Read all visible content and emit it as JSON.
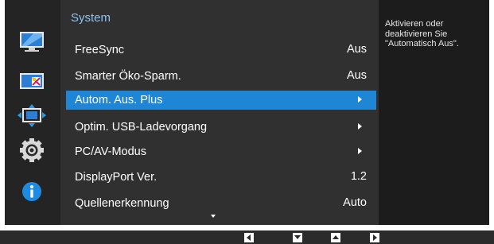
{
  "menu": {
    "title": "System",
    "items": [
      {
        "label": "FreeSync",
        "value": "Aus",
        "type": "value"
      },
      {
        "label": "Smarter Öko-Sparm.",
        "value": "Aus",
        "type": "value"
      },
      {
        "label": "Autom. Aus. Plus",
        "value": "",
        "type": "arrow",
        "selected": true
      },
      {
        "label": "Optim. USB-Ladevorgang",
        "value": "",
        "type": "arrow"
      },
      {
        "label": "PC/AV-Modus",
        "value": "",
        "type": "arrow"
      },
      {
        "label": "DisplayPort Ver.",
        "value": "1.2",
        "type": "value"
      },
      {
        "label": "Quellenerkennung",
        "value": "Auto",
        "type": "value"
      }
    ]
  },
  "help": {
    "text": "Aktivieren oder deaktivieren Sie \"Automatisch Aus\"."
  },
  "sidebar": {
    "icons": [
      "picture-icon",
      "onscreen-display-icon",
      "position-icon",
      "system-gear-icon",
      "information-icon"
    ],
    "active": "system-gear-icon"
  },
  "bottom_keys": [
    "left-key-icon",
    "down-key-icon",
    "up-key-icon",
    "right-key-icon"
  ],
  "colors": {
    "selection": "#1f86d6",
    "title": "#8fc1ef",
    "info": "#1f8be0"
  }
}
